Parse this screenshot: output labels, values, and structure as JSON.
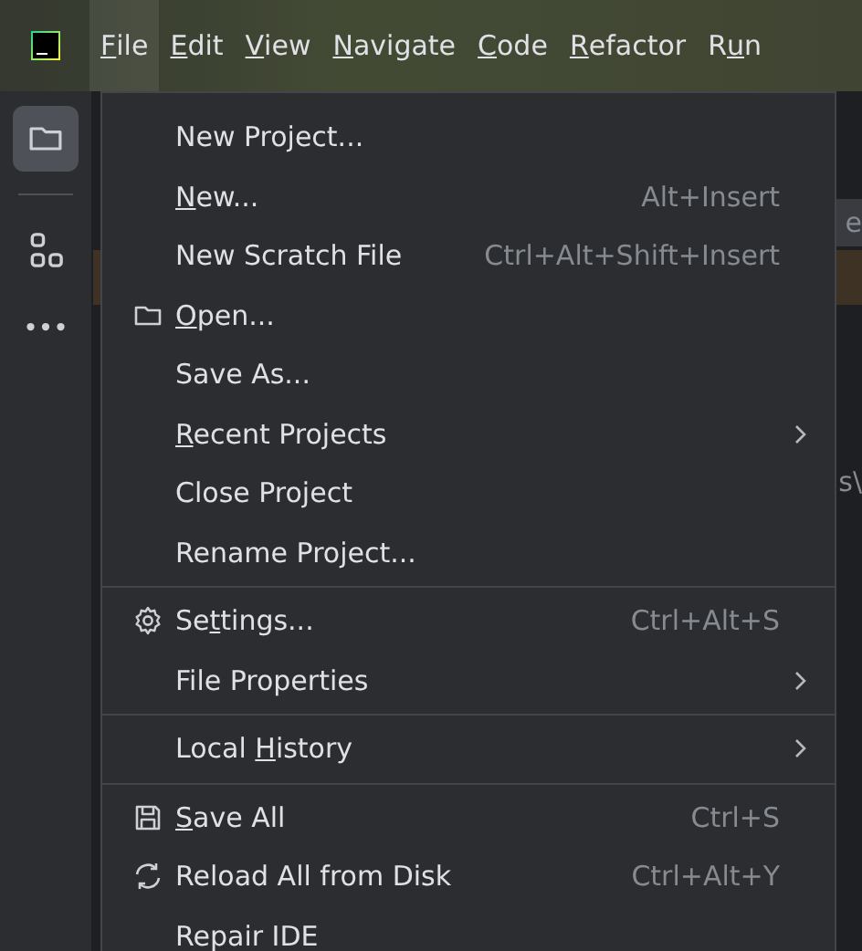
{
  "title_bar": {
    "menus": [
      {
        "mnemonic": "F",
        "label_end": "ile",
        "selected": true
      },
      {
        "mnemonic": "E",
        "label_end": "dit",
        "selected": false
      },
      {
        "mnemonic": "V",
        "label_end": "iew",
        "selected": false
      },
      {
        "mnemonic": "N",
        "label_end": "avigate",
        "selected": false
      },
      {
        "mnemonic": "C",
        "label_end": "ode",
        "selected": false
      },
      {
        "mnemonic": "R",
        "label_end": "efactor",
        "selected": false
      },
      {
        "label_start": "R",
        "mnemonic": "u",
        "label_end": "n",
        "selected": false
      }
    ]
  },
  "tool_strip": {
    "buttons": [
      {
        "kind": "folder",
        "selected": true
      },
      {
        "kind": "separator"
      },
      {
        "kind": "structure",
        "selected": false
      },
      {
        "kind": "more",
        "selected": false
      }
    ]
  },
  "editor": {
    "fragments": [
      {
        "kind": "tab",
        "text": "e"
      },
      {
        "kind": "highlight"
      },
      {
        "kind": "line",
        "text": "s\\"
      }
    ]
  },
  "file_menu": {
    "rows": [
      {
        "kind": "plain",
        "label_start": "New Project...",
        "submenu": false
      },
      {
        "kind": "plain",
        "mnemonic": "N",
        "label_end": "ew...",
        "shortcut": "Alt+Insert",
        "submenu": false
      },
      {
        "kind": "plain",
        "label_start": "New Scratch File",
        "shortcut": "Ctrl+Alt+Shift+Insert",
        "submenu": false
      },
      {
        "kind": "folder",
        "mnemonic": "O",
        "label_end": "pen...",
        "submenu": false
      },
      {
        "kind": "plain",
        "label_start": "Save As...",
        "submenu": false
      },
      {
        "kind": "plain",
        "mnemonic": "R",
        "label_end": "ecent Projects",
        "submenu": true
      },
      {
        "kind": "plain",
        "label_start": "Close Project",
        "submenu": false
      },
      {
        "kind": "plain",
        "label_start": "Rename Project...",
        "submenu": false
      },
      {
        "kind": "separator"
      },
      {
        "kind": "gear",
        "label_start": "Se",
        "mnemonic": "t",
        "label_end": "tings...",
        "shortcut": "Ctrl+Alt+S",
        "submenu": false
      },
      {
        "kind": "plain",
        "label_start": "File Properties",
        "submenu": true
      },
      {
        "kind": "separator"
      },
      {
        "kind": "plain",
        "label_start": "Local ",
        "mnemonic": "H",
        "label_end": "istory",
        "submenu": true
      },
      {
        "kind": "separator"
      },
      {
        "kind": "save",
        "mnemonic": "S",
        "label_end": "ave All",
        "shortcut": "Ctrl+S",
        "submenu": false
      },
      {
        "kind": "reload",
        "label_start": "Reload All from Disk",
        "shortcut": "Ctrl+Alt+Y",
        "submenu": false
      },
      {
        "kind": "plain",
        "label_start": "Repair IDE",
        "submenu": false
      }
    ]
  }
}
